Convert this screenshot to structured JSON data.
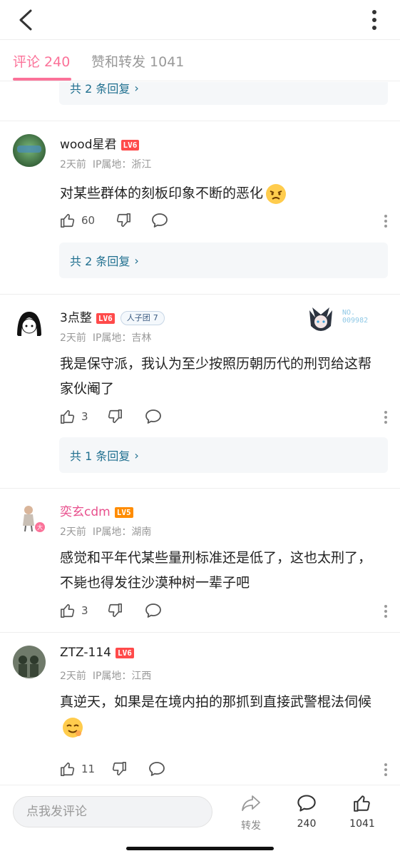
{
  "tabs": {
    "comments_label": "评论 240",
    "likes_label": "赞和转发 1041"
  },
  "replies_top": {
    "label": "共 2 条回复"
  },
  "comments": [
    {
      "username": "wood星君",
      "level": "LV6",
      "time": "2天前",
      "ip": "IP属地：浙江",
      "text": "对某些群体的刻板印象不断的恶化",
      "emoji": "annoyed-face-emoji",
      "likes": "60",
      "replies": "共 2 条回复"
    },
    {
      "username": "3点整",
      "level": "LV6",
      "badge": "人子团",
      "badge_num": "7",
      "fan_no": "NO.",
      "fan_no_value": "009982",
      "time": "2天前",
      "ip": "IP属地：吉林",
      "text": "我是保守派，我认为至少按照历朝历代的刑罚给这帮家伙阉了",
      "likes": "3",
      "replies": "共 1 条回复"
    },
    {
      "username": "奕玄cdm",
      "level": "LV5",
      "time": "2天前",
      "ip": "IP属地：湖南",
      "text": "感觉和平年代某些量刑标准还是低了，这也太刑了，不毙也得发往沙漠种树一辈子吧",
      "likes": "3"
    },
    {
      "username": "ZTZ-114",
      "level": "LV6",
      "time": "2天前",
      "ip": "IP属地：江西",
      "text": "真逆天，如果是在境内拍的那抓到直接武警棍法伺候",
      "emoji": "smirk-face-emoji",
      "likes": "11"
    }
  ],
  "bottom": {
    "input_placeholder": "点我发评论",
    "share_label": "转发",
    "comment_count": "240",
    "like_count": "1041"
  },
  "colors": {
    "accent": "#fb7299",
    "link": "#1f6f8f",
    "lv6": "#ff4a4a",
    "lv5": "#ff8c00"
  }
}
